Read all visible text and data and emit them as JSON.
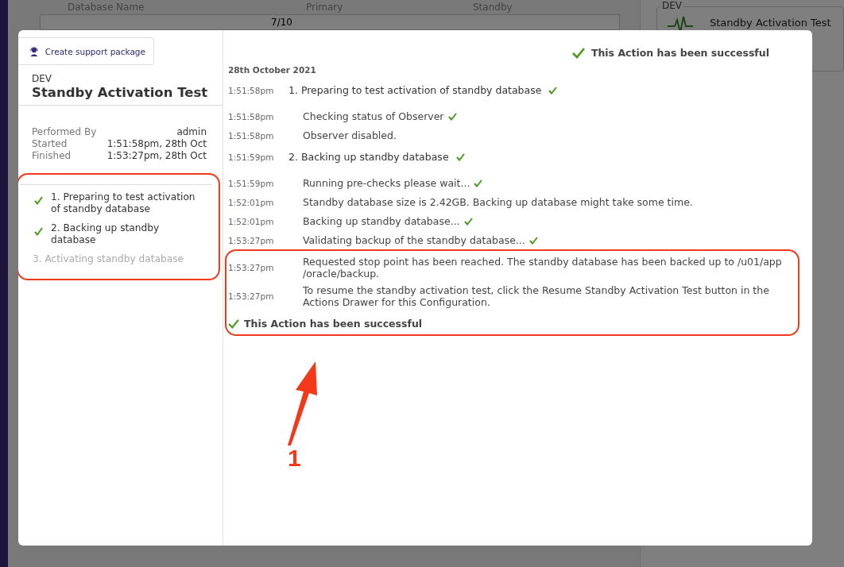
{
  "background": {
    "table": {
      "columns": [
        "Database Name",
        "Primary",
        "Standby"
      ],
      "row": {
        "count": "7/10"
      }
    },
    "panel": {
      "legend": "DEV",
      "title": "Standby Activation Test"
    }
  },
  "dialog": {
    "support_button": "Create support package",
    "config": "DEV",
    "title": "Standby Activation Test",
    "details": [
      {
        "label": "Performed By",
        "value": "admin"
      },
      {
        "label": "Started",
        "value": "1:51:58pm, 28th Oct"
      },
      {
        "label": "Finished",
        "value": "1:53:27pm, 28th Oct"
      }
    ],
    "steps": {
      "highlighted": true,
      "items": [
        {
          "label": "1. Preparing to test activation of standby database",
          "done": true
        },
        {
          "label": "2. Backing up standby database",
          "done": true
        },
        {
          "label": "3. Activating standby database",
          "done": false
        }
      ]
    },
    "status": "This Action has been successful",
    "date": "28th October 2021",
    "log": [
      {
        "time": "1:51:58pm",
        "text": "1. Preparing to test activation of standby database",
        "kind": "step",
        "success": true
      },
      {
        "time": "1:51:58pm",
        "text": "Checking status of Observer",
        "kind": "detail",
        "success": true
      },
      {
        "time": "1:51:58pm",
        "text": "Observer disabled.",
        "kind": "detail",
        "success": false
      },
      {
        "time": "1:51:59pm",
        "text": "2. Backing up standby database",
        "kind": "step",
        "success": true
      },
      {
        "time": "1:51:59pm",
        "text": "Running pre-checks please wait...",
        "kind": "detail",
        "success": true
      },
      {
        "time": "1:52:01pm",
        "text": "Standby database size is 2.42GB. Backing up database might take some time.",
        "kind": "detail",
        "success": false
      },
      {
        "time": "1:52:01pm",
        "text": "Backing up standby database...",
        "kind": "detail",
        "success": true
      },
      {
        "time": "1:53:27pm",
        "text": "Validating backup of the standby database...",
        "kind": "detail",
        "success": true
      }
    ],
    "highlight": {
      "entries": [
        {
          "time": "1:53:27pm",
          "text": "Requested stop point has been reached. The standby database has been backed up to /u01/app /oracle/backup.",
          "kind": "detail",
          "success": false
        },
        {
          "time": "1:53:27pm",
          "text": "To resume the standby activation test, click the Resume Standby Activation Test button in the Actions Drawer for this Configuration.",
          "kind": "detail",
          "success": false
        }
      ],
      "result": "This Action has been successful"
    }
  },
  "annotation": {
    "label": "1"
  }
}
